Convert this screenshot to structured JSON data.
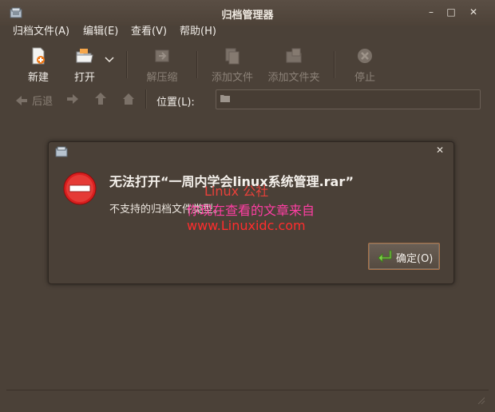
{
  "window": {
    "title": "归档管理器",
    "minimize": "–",
    "maximize": "□",
    "close": "✕"
  },
  "menu": [
    "归档文件(A)",
    "编辑(E)",
    "查看(V)",
    "帮助(H)"
  ],
  "toolbar": {
    "new": "新建",
    "open": "打开",
    "extract": "解压缩",
    "add_files": "添加文件",
    "add_folder": "添加文件夹",
    "stop": "停止"
  },
  "location": {
    "back": "后退",
    "label": "位置(L):"
  },
  "dialog": {
    "close": "✕",
    "primary": "无法打开“一周内学会linux系统管理.rar”",
    "secondary": "不支持的归档文件类型。",
    "ok": "确定(O)"
  },
  "watermark": {
    "line1": "Linux 公社",
    "line2": "你现在查看的文章来自",
    "line3": "www.Linuxidc.com"
  },
  "colors": {
    "accent_border": "#a8724a",
    "error_red": "#d91f1f",
    "ok_green": "#7ed04a"
  }
}
